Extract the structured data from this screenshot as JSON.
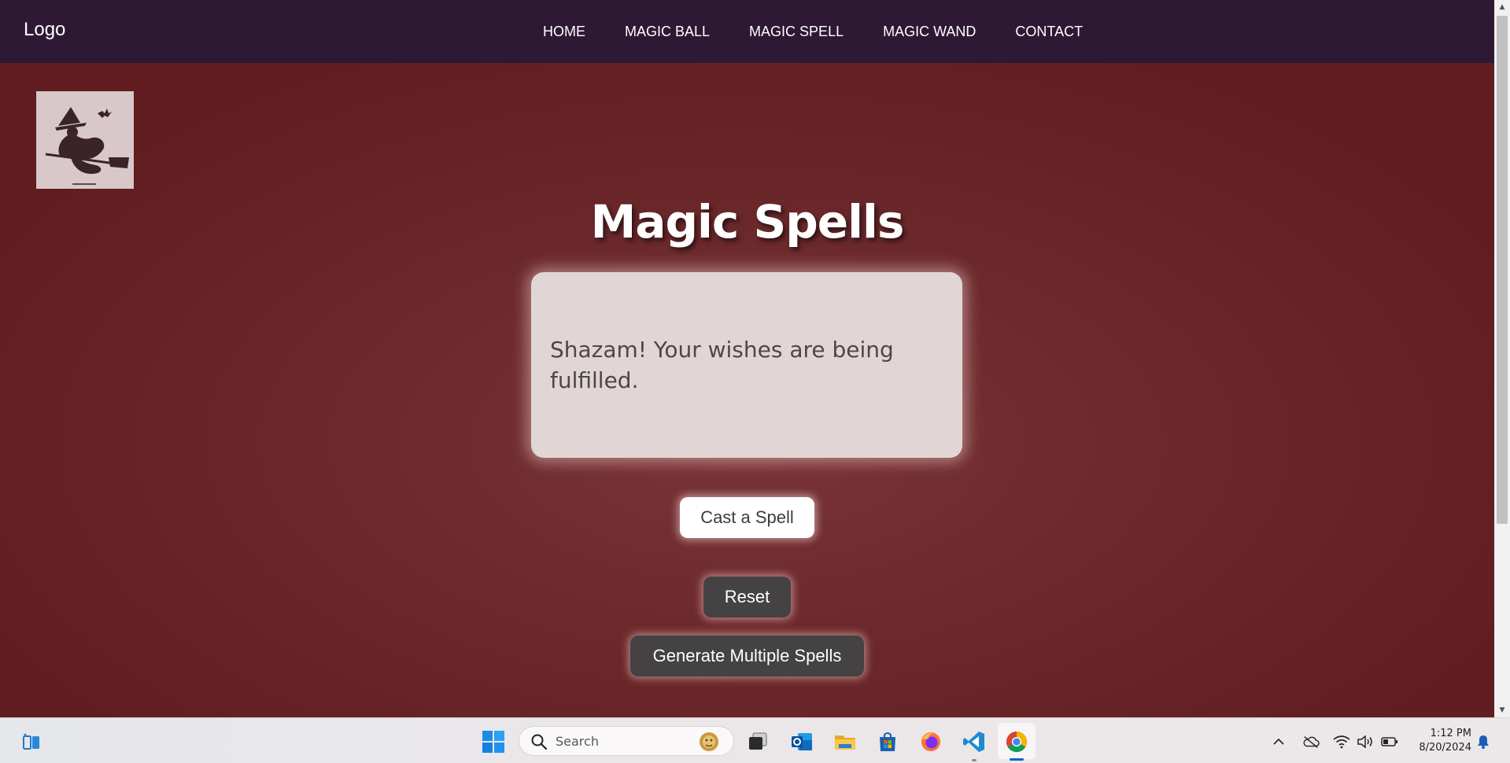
{
  "navbar": {
    "logo": "Logo",
    "links": [
      "HOME",
      "MAGIC BALL",
      "MAGIC SPELL",
      "MAGIC WAND",
      "CONTACT"
    ]
  },
  "main": {
    "title": "Magic Spells",
    "spell_text": "Shazam! Your wishes are being fulfilled.",
    "buttons": {
      "cast": "Cast a Spell",
      "reset": "Reset",
      "multiple": "Generate Multiple Spells"
    }
  },
  "taskbar": {
    "search_placeholder": "Search",
    "apps": [
      "start-icon",
      "search-box",
      "task-view-icon",
      "outlook-icon",
      "file-explorer-icon",
      "store-icon",
      "firefox-icon",
      "vscode-icon",
      "chrome-icon"
    ],
    "clock_time": "1:12 PM",
    "clock_date": "8/20/2024"
  },
  "colors": {
    "navbar_bg": "#2e1934",
    "page_bg": "#6c2a2c",
    "card_bg": "#e1d6d6",
    "dark_button": "#444242"
  }
}
